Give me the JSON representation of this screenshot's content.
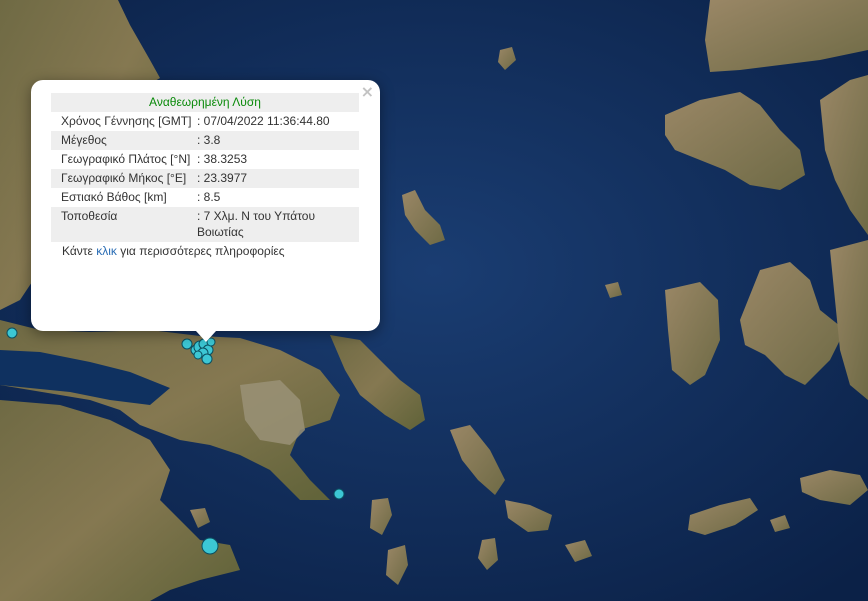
{
  "popup": {
    "title": "Αναθεωρημένη Λύση",
    "close_glyph": "×",
    "rows": [
      {
        "label": "Χρόνος Γέννησης [GMT]",
        "value": ": 07/04/2022 11:36:44.80"
      },
      {
        "label": "Μέγεθος",
        "value": ": 3.8"
      },
      {
        "label": "Γεωγραφικό Πλάτος [°N]",
        "value": ": 38.3253"
      },
      {
        "label": "Γεωγραφικό Μήκος [°E]",
        "value": ": 23.3977"
      },
      {
        "label": "Εστιακό Βάθος [km]",
        "value": ": 8.5"
      },
      {
        "label": "Τοποθεσία",
        "value": ": 7 Χλμ. Ν του Υπάτου Βοιωτίας"
      }
    ],
    "more_prefix": "Κάντε",
    "more_link": "κλικ",
    "more_suffix": "για περισσότερες πληροφορίες"
  },
  "map": {
    "sea_color": "#0d2a55",
    "land_color": "#7a7045",
    "marker_color": "#3cc7d4",
    "marker_stroke": "#0b4f60"
  }
}
